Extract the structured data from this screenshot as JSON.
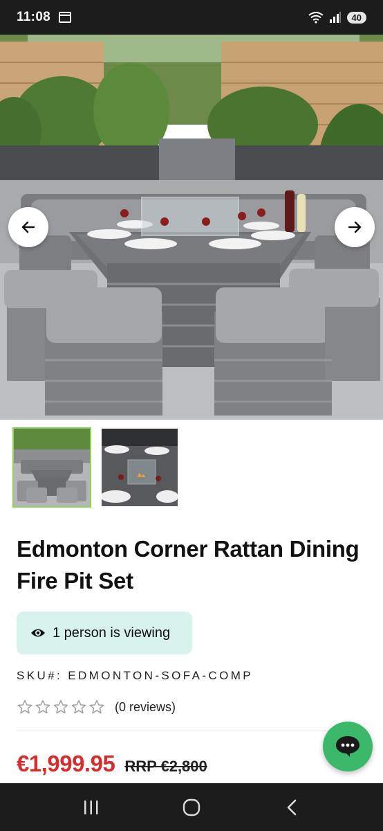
{
  "status_bar": {
    "time": "11:08",
    "battery": "40",
    "icons": [
      "calendar-icon",
      "wifi-icon",
      "signal-icon",
      "battery-icon"
    ]
  },
  "gallery": {
    "prev_icon": "arrow-left-icon",
    "next_icon": "arrow-right-icon",
    "thumbnails": [
      {
        "name": "thumb-full-set",
        "active": true
      },
      {
        "name": "thumb-fire-pit-closeup",
        "active": false
      }
    ]
  },
  "product": {
    "title": "Edmonton Corner Rattan Dining Fire Pit Set",
    "viewing": "1 person is viewing",
    "sku_label": "SKU#:",
    "sku_value": "EDMONTON-SOFA-COMP",
    "rating_stars": 0,
    "reviews": "(0 reviews)",
    "price": "€1,999.95",
    "rrp": "RRP €2,800"
  },
  "colors": {
    "price": "#d32f2f",
    "badge_bg": "#d7f3ec",
    "chat_button": "#3bb86a",
    "thumb_active_border": "#8fd15e"
  },
  "android_nav": [
    "recents-icon",
    "home-icon",
    "back-icon"
  ]
}
